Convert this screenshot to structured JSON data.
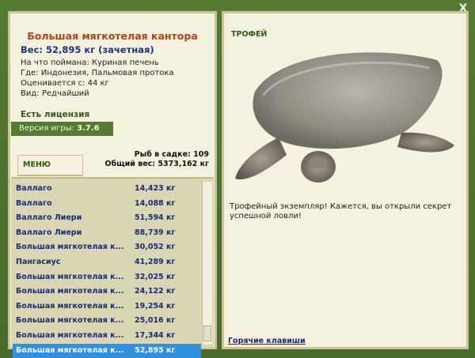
{
  "window": {
    "close_label": "X"
  },
  "fish_card": {
    "title": "Большая мягкотелая кантора",
    "weight": "Вес: 52,895 кг (зачетная)",
    "bait": "На что поймана: Куриная печень",
    "where": "Где: Индонезия, Пальмовая протока",
    "value": "Оценивается с: 44 кг",
    "kind": "Вид: Редчайший"
  },
  "license": "Есть лицензия",
  "version": {
    "label": "Версия игры:",
    "value": "3.7.6"
  },
  "menu_label": "МЕНЮ",
  "counts": {
    "fish_in_keepnet": "Рыб в садке: 109",
    "total_weight": "Общий вес: 5373,162 кг"
  },
  "catch_list": [
    {
      "name": "Валлаго",
      "weight": "14,423 кг"
    },
    {
      "name": "Валлаго",
      "weight": "14,088 кг"
    },
    {
      "name": "Валлаго Лиери",
      "weight": "51,594 кг"
    },
    {
      "name": "Валлаго Лиери",
      "weight": "88,739 кг"
    },
    {
      "name": "Большая мягкотелая к...",
      "weight": "30,052 кг"
    },
    {
      "name": "Пангасиус",
      "weight": "41,289 кг"
    },
    {
      "name": "Большая мягкотелая к...",
      "weight": "32,025 кг"
    },
    {
      "name": "Большая мягкотелая к...",
      "weight": "24,122 кг"
    },
    {
      "name": "Большая мягкотелая к...",
      "weight": "19,254 кг"
    },
    {
      "name": "Большая мягкотелая к...",
      "weight": "25,016 кг"
    },
    {
      "name": "Большая мягкотелая к...",
      "weight": "17,344 кг"
    },
    {
      "name": "Большая мягкотелая к...",
      "weight": "52,895 кг",
      "selected": true
    }
  ],
  "trophy": {
    "label": "ТРОФЕЙ",
    "text": "Трофейный экземпляр! Кажется, вы открыли секрет успешной ловли!"
  },
  "hotkeys_label": "Горячие клавиши",
  "colors": {
    "frame_green": "#557a33",
    "panel_bg": "#f4f1df",
    "title_red": "#b3401f",
    "link_blue": "#1a2a7a",
    "selected_row": "#2f8fe0"
  }
}
